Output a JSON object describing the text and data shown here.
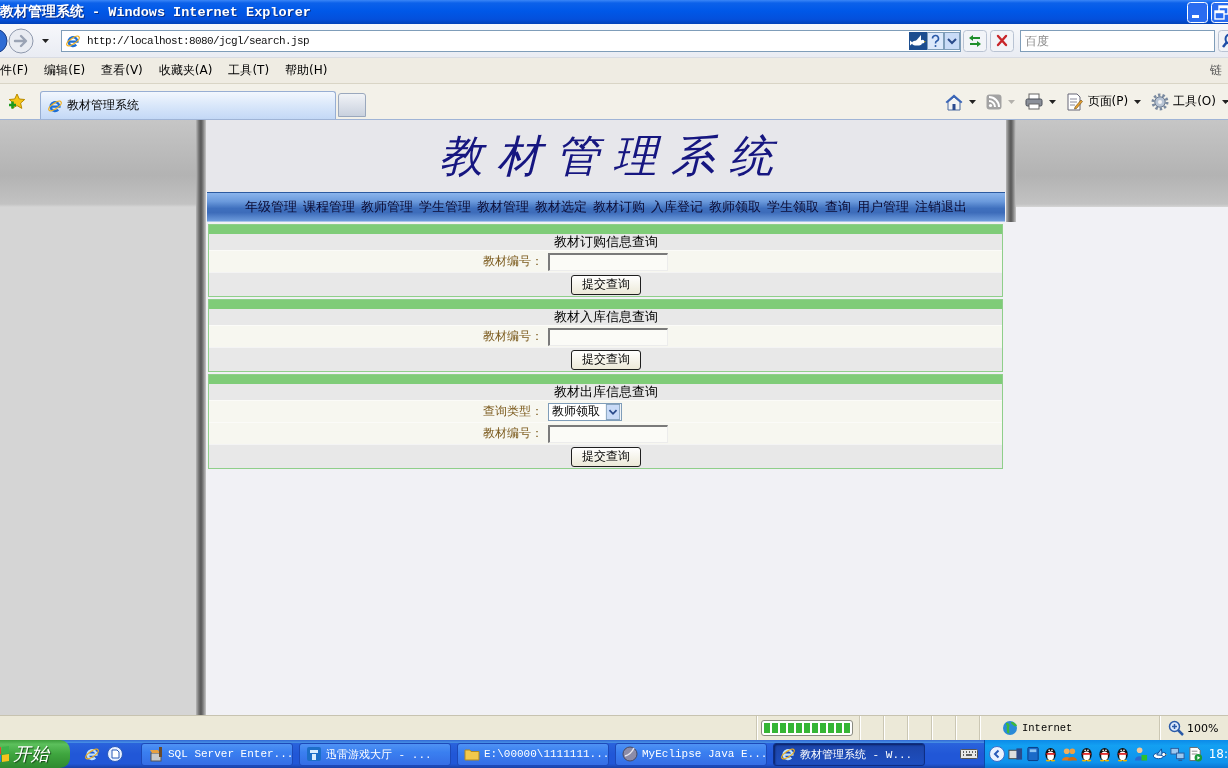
{
  "window": {
    "title": "教材管理系统 - Windows Internet Explorer"
  },
  "address_bar": {
    "url": "http://localhost:8080/jcgl/search.jsp"
  },
  "search": {
    "placeholder": "百度"
  },
  "menu_bar": {
    "items": [
      "件(F)",
      "编辑(E)",
      "查看(V)",
      "收藏夹(A)",
      "工具(T)",
      "帮助(H)"
    ],
    "links": "链"
  },
  "tabs": [
    {
      "label": "教材管理系统",
      "selected": true
    }
  ],
  "command_bar": [
    {
      "kind": "home",
      "disabled": false
    },
    {
      "kind": "feeds",
      "disabled": true
    },
    {
      "kind": "print",
      "disabled": false
    },
    {
      "kind": "page",
      "label": "页面(P)",
      "disabled": false
    },
    {
      "kind": "tools",
      "label": "工具(O)",
      "disabled": false
    }
  ],
  "page": {
    "title": "教材管理系统",
    "nav": [
      "年级管理",
      "课程管理",
      "教师管理",
      "学生管理",
      "教材管理",
      "教材选定",
      "教材订购",
      "入库登记",
      "教师领取",
      "学生领取",
      "查询",
      "用户管理",
      "注销退出"
    ],
    "forms": [
      {
        "title": "教材订购信息查询",
        "fields": [
          {
            "kind": "input",
            "label": "教材编号："
          }
        ],
        "button": "提交查询"
      },
      {
        "title": "教材入库信息查询",
        "fields": [
          {
            "kind": "input",
            "label": "教材编号："
          }
        ],
        "button": "提交查询"
      },
      {
        "title": "教材出库信息查询",
        "fields": [
          {
            "kind": "select",
            "label": "查询类型：",
            "value": "教师领取"
          },
          {
            "kind": "input",
            "label": "教材编号："
          }
        ],
        "button": "提交查询"
      }
    ]
  },
  "status_bar": {
    "progress": {
      "level": 1
    },
    "zone": "Internet",
    "zoom": "100%"
  },
  "taskbar": {
    "start": "开始",
    "buttons": [
      {
        "label": "SQL Server Enter...",
        "selected": false
      },
      {
        "label": "迅雷游戏大厅 - ...",
        "selected": false
      },
      {
        "label": "E:\\00000\\1111111...",
        "selected": false
      },
      {
        "label": "MyEclipse Java E...",
        "selected": false
      },
      {
        "label": "教材管理系统 - W...",
        "selected": true
      }
    ],
    "clock": "18:"
  }
}
